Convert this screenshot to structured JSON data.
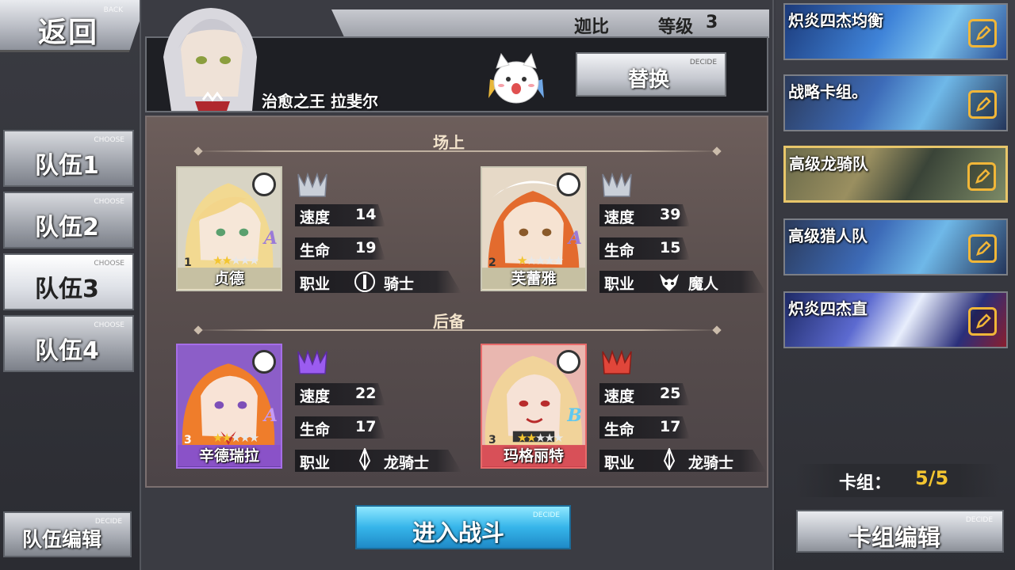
{
  "back": {
    "label": "返回",
    "tag": "BACK"
  },
  "teams": [
    {
      "label": "队伍1",
      "tag": "CHOOSE",
      "active": false
    },
    {
      "label": "队伍2",
      "tag": "CHOOSE",
      "active": false
    },
    {
      "label": "队伍3",
      "tag": "CHOOSE",
      "active": true
    },
    {
      "label": "队伍4",
      "tag": "CHOOSE",
      "active": false
    }
  ],
  "team_edit": {
    "label": "队伍编辑",
    "tag": "DECIDE"
  },
  "player": {
    "name": "迦比",
    "level_label": "等级",
    "level": "3"
  },
  "leader": {
    "title": "治愈之王 拉斐尔"
  },
  "replace": {
    "label": "替换",
    "tag": "DECIDE"
  },
  "sections": {
    "field": "场上",
    "reserve": "后备"
  },
  "stat_labels": {
    "speed": "速度",
    "hp": "生命",
    "job": "职业"
  },
  "field_units": [
    {
      "index": "1",
      "name": "贞德",
      "stars": 2,
      "max_stars": 5,
      "grade": "A",
      "speed": "14",
      "hp": "19",
      "job": "骑士",
      "job_icon": "knight-icon",
      "rank_color": "#c9cfd8"
    },
    {
      "index": "2",
      "name": "芙蕾雅",
      "stars": 1,
      "max_stars": 5,
      "grade": "A",
      "speed": "39",
      "hp": "15",
      "job": "魔人",
      "job_icon": "demon-icon",
      "rank_color": "#c9cfd8"
    }
  ],
  "reserve_units": [
    {
      "index": "3",
      "name": "辛德瑞拉",
      "stars": 2,
      "max_stars": 5,
      "grade": "A",
      "speed": "22",
      "hp": "17",
      "job": "龙骑士",
      "job_icon": "dragoon-icon",
      "rank_color": "#9b5cf0"
    },
    {
      "index": "3",
      "name": "玛格丽特",
      "stars": 2,
      "max_stars": 5,
      "grade": "B",
      "speed": "25",
      "hp": "17",
      "job": "龙骑士",
      "job_icon": "dragoon-icon",
      "rank_color": "#e0463a"
    }
  ],
  "battle": {
    "label": "进入战斗",
    "tag": "DECIDE"
  },
  "decks": [
    {
      "label": "炽炎四杰均衡",
      "selected": false
    },
    {
      "label": "战略卡组。",
      "selected": false
    },
    {
      "label": "高级龙骑队",
      "selected": true
    },
    {
      "label": "高级猎人队",
      "selected": false
    },
    {
      "label": "炽炎四杰直",
      "selected": false
    }
  ],
  "deck_count": {
    "label": "卡组：",
    "value": "5/5"
  },
  "deck_edit": {
    "label": "卡组编辑",
    "tag": "DECIDE"
  },
  "colors": {
    "accent_gold": "#f3c530",
    "battle_blue": "#36b5ea",
    "selected_border": "#e8c66a"
  }
}
